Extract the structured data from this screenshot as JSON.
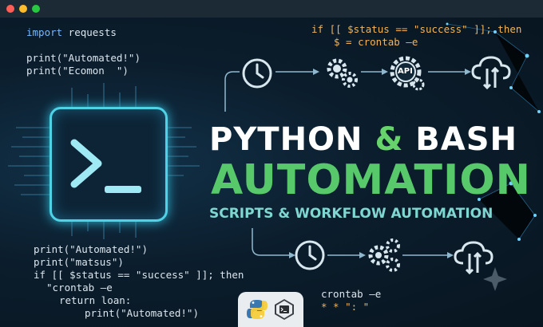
{
  "code_top_left": {
    "line1_kw": "import",
    "line1_rest": " requests",
    "line2": "print(\"Automated!\")",
    "line3": "print(\"Ecomon  \")"
  },
  "code_top_right": {
    "line1": "if [[ $status == \"success\" ]]; then",
    "line2": "$ = crontab –e"
  },
  "code_bottom_left": {
    "line1": "print(\"Automated!\")",
    "line2": "print(\"matsus\")",
    "line3": "if [[ $status == \"success\" ]]; then",
    "line4": "\"crontab –e",
    "line5": "return loan:",
    "line6": "print(\"Automated!\")"
  },
  "code_bottom_right": {
    "line1": "crontab –e",
    "line2": "* * \": \""
  },
  "headline": {
    "python": "PYTHON",
    "amp": "&",
    "bash": "BASH",
    "automation": "AUTOMATION",
    "subtitle": "SCRIPTS & WORKFLOW AUTOMATION"
  },
  "api_label": "API",
  "terminal_prompt": ">_",
  "colors": {
    "accent_green": "#57c96a",
    "accent_cyan": "#4fd1e6",
    "accent_amber": "#f2b45a"
  },
  "icons": [
    "clock-icon",
    "gears-icon",
    "api-gear-icon",
    "cloud-sync-icon",
    "python-logo-icon",
    "bash-logo-icon",
    "terminal-icon"
  ]
}
